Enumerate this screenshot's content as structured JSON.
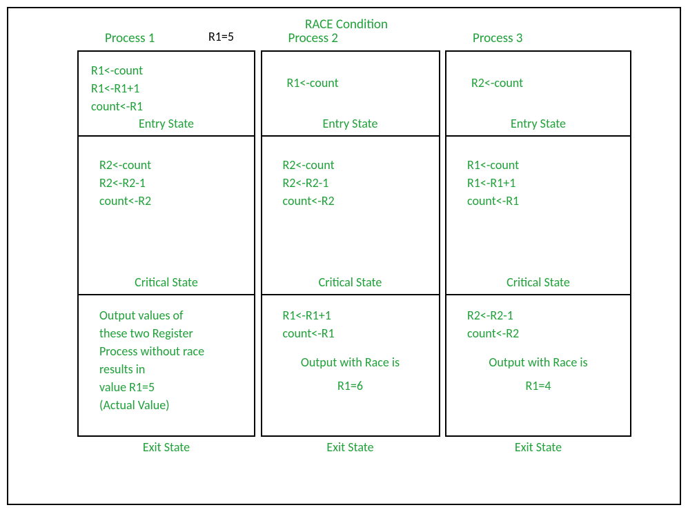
{
  "title": "RACE Condition",
  "register_note": "R1=5",
  "processes": [
    {
      "name": "Process 1",
      "entry_code": "R1<-count\nR1<-R1+1\ncount<-R1",
      "critical_code": "R2<-count\nR2<-R2-1\ncount<-R2",
      "exit_text": "Output values of\nthese two Register\nProcess without race\nresults in\nvalue R1=5\n(Actual Value)"
    },
    {
      "name": "Process 2",
      "entry_code": "R1<-count",
      "critical_code": "R2<-count\nR2<-R2-1\ncount<-R2",
      "exit_code": "R1<-R1+1\ncount<-R1",
      "exit_output_label": "Output with Race is",
      "exit_output_value": "R1=6"
    },
    {
      "name": "Process 3",
      "entry_code": "R2<-count",
      "critical_code": "R1<-count\nR1<-R1+1\ncount<-R1",
      "exit_code": "R2<-R2-1\ncount<-R2",
      "exit_output_label": "Output with Race is",
      "exit_output_value": "R1=4"
    }
  ],
  "labels": {
    "entry": "Entry State",
    "critical": "Critical State",
    "exit": "Exit State"
  }
}
